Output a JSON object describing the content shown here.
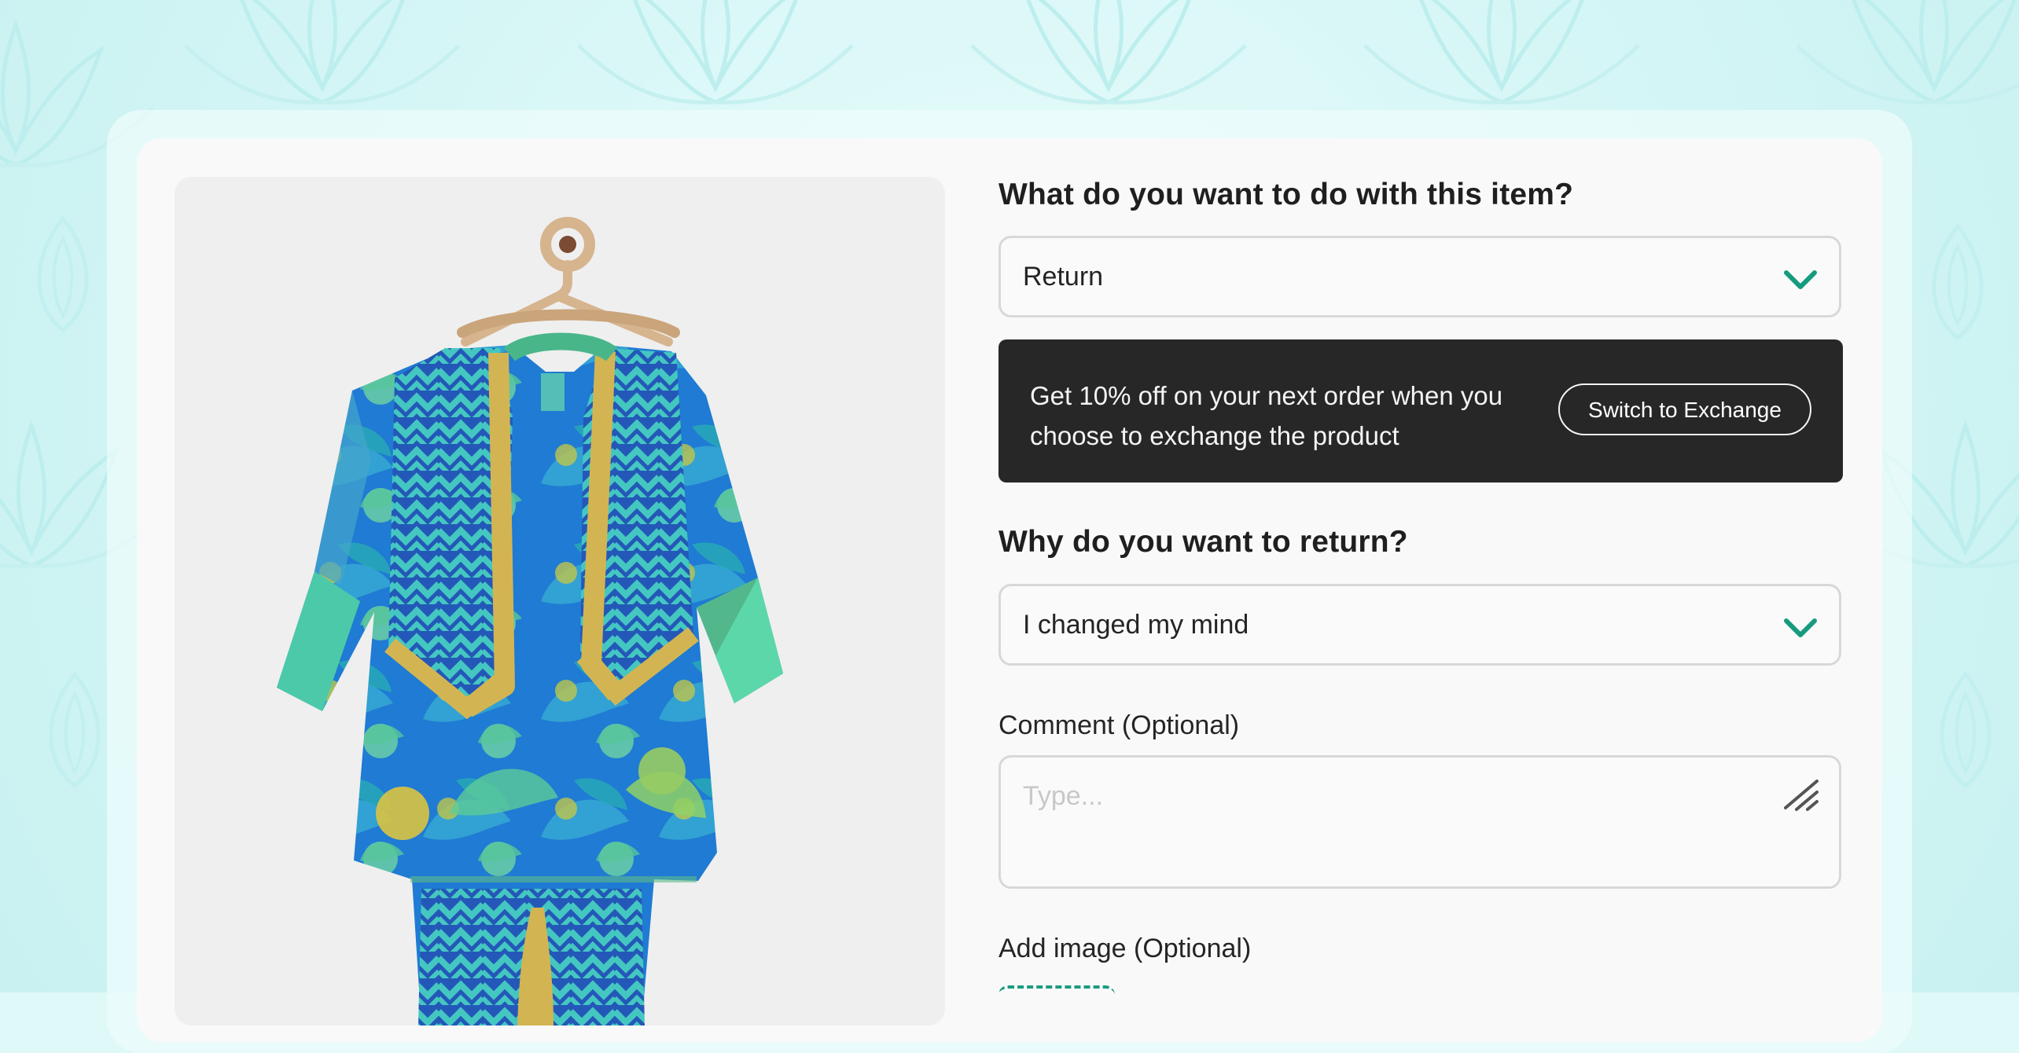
{
  "theme": {
    "accent_color": "#169b7f",
    "dark_banner_color": "#272727"
  },
  "product": {
    "image_alt": "Kids ethnic kurta set with printed jacket on a hanger"
  },
  "action": {
    "title": "What do you want to do with this item?",
    "selected_value": "Return",
    "chevron_icon": "chevron-down-icon"
  },
  "promo": {
    "text": "Get 10% off on your next order when you choose to exchange the product",
    "button_label": "Switch to Exchange"
  },
  "reason": {
    "title": "Why do you want to return?",
    "selected_value": "I changed my mind",
    "chevron_icon": "chevron-down-icon"
  },
  "comment": {
    "label": "Comment (Optional)",
    "placeholder": "Type...",
    "resize_icon": "resize-handle-icon"
  },
  "image_upload": {
    "label": "Add image (Optional)"
  }
}
